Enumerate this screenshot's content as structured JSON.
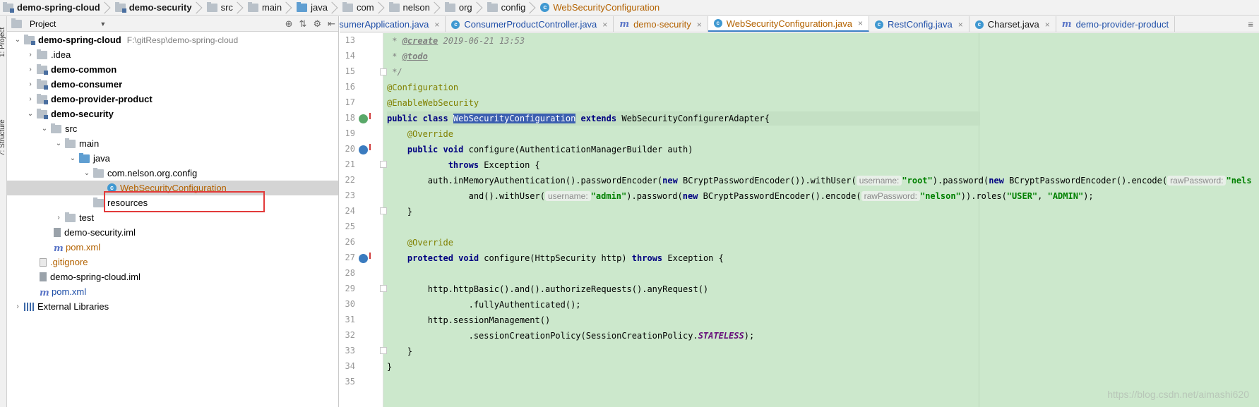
{
  "breadcrumb": [
    {
      "label": "demo-spring-cloud",
      "bold": true
    },
    {
      "label": "demo-security",
      "bold": true
    },
    {
      "label": "src"
    },
    {
      "label": "main"
    },
    {
      "label": "java"
    },
    {
      "label": "com"
    },
    {
      "label": "nelson"
    },
    {
      "label": "org"
    },
    {
      "label": "config"
    },
    {
      "label": "WebSecurityConfiguration",
      "current": true
    }
  ],
  "side_strip": {
    "project_tab": "1: Project",
    "structure_tab": "7: Structure"
  },
  "project_panel": {
    "title": "Project",
    "tree": [
      {
        "label": "demo-spring-cloud",
        "path": "F:\\gitResp\\demo-spring-cloud",
        "bold": true,
        "arrow": "down",
        "icon": "module"
      },
      {
        "label": ".idea",
        "arrow": "right",
        "icon": "folder"
      },
      {
        "label": "demo-common",
        "bold": true,
        "arrow": "right",
        "icon": "module"
      },
      {
        "label": "demo-consumer",
        "bold": true,
        "arrow": "right",
        "icon": "module"
      },
      {
        "label": "demo-provider-product",
        "bold": true,
        "arrow": "right",
        "icon": "module"
      },
      {
        "label": "demo-security",
        "bold": true,
        "arrow": "down",
        "icon": "module"
      },
      {
        "label": "src",
        "arrow": "down",
        "icon": "folder"
      },
      {
        "label": "main",
        "arrow": "down",
        "icon": "folder"
      },
      {
        "label": "java",
        "arrow": "down",
        "icon": "folder-blue"
      },
      {
        "label": "com.nelson.org.config",
        "arrow": "down",
        "icon": "folder"
      },
      {
        "label": "WebSecurityConfiguration",
        "icon": "class",
        "selected": true
      },
      {
        "label": "resources",
        "icon": "folder"
      },
      {
        "label": "test",
        "arrow": "right",
        "icon": "folder"
      },
      {
        "label": "demo-security.iml",
        "icon": "iml"
      },
      {
        "label": "pom.xml",
        "icon": "maven"
      },
      {
        "label": ".gitignore",
        "icon": "git"
      },
      {
        "label": "demo-spring-cloud.iml",
        "icon": "iml"
      },
      {
        "label": "pom.xml",
        "icon": "maven"
      },
      {
        "label": "External Libraries",
        "arrow": "right",
        "icon": "library"
      }
    ]
  },
  "tabs": [
    {
      "label": "nsumerApplication.java",
      "icon": "class",
      "closable": true
    },
    {
      "label": "ConsumerProductController.java",
      "icon": "class",
      "closable": true
    },
    {
      "label": "demo-security",
      "icon": "maven",
      "closable": true
    },
    {
      "label": "WebSecurityConfiguration.java",
      "icon": "class",
      "closable": true,
      "active": true
    },
    {
      "label": "RestConfig.java",
      "icon": "class",
      "closable": true
    },
    {
      "label": "Charset.java",
      "icon": "class",
      "closable": true
    },
    {
      "label": "demo-provider-product",
      "icon": "maven",
      "closable": false
    }
  ],
  "editor": {
    "line_numbers": [
      "13",
      "14",
      "15",
      "16",
      "17",
      "18",
      "19",
      "20",
      "21",
      "22",
      "23",
      "24",
      "25",
      "26",
      "27",
      "28",
      "29",
      "30",
      "31",
      "32",
      "33",
      "34",
      "35"
    ],
    "lines": {
      "l13a": " * ",
      "l13tag": "@create",
      "l13b": " 2019-06-21 13:53",
      "l14a": " * ",
      "l14tag": "@todo",
      "l15": " */",
      "l16": "@Configuration",
      "l17": "@EnableWebSecurity",
      "l18kw": "public class ",
      "l18sel": "WebSecurityConfiguration",
      "l18kw2": " extends ",
      "l18b": "WebSecurityConfigurerAdapter{",
      "l19": "    @Override",
      "l20kw": "    public void ",
      "l20b": "configure(AuthenticationManagerBuilder auth)",
      "l21kw": "            throws ",
      "l21b": "Exception {",
      "l22a": "        auth.inMemoryAuthentication().passwordEncoder(",
      "l22kw": "new ",
      "l22b": "BCryptPasswordEncoder()).withUser(",
      "l22hint1": "username:",
      "l22str1": "\"root\"",
      "l22c": ").password(",
      "l22kw2": "new ",
      "l22d": "BCryptPasswordEncoder().encode(",
      "l22hint2": "rawPassword:",
      "l22str2": "\"nels",
      "l23a": "                and().withUser(",
      "l23hint1": "username:",
      "l23str1": "\"admin\"",
      "l23b": ").password(",
      "l23kw": "new ",
      "l23c": "BCryptPasswordEncoder().encode(",
      "l23hint2": "rawPassword:",
      "l23str2": "\"nelson\"",
      "l23d": ")).roles(",
      "l23str3": "\"USER\"",
      "l23e": ", ",
      "l23str4": "\"ADMIN\"",
      "l23f": ");",
      "l24": "    }",
      "l26": "    @Override",
      "l27kw": "    protected void ",
      "l27b": "configure(HttpSecurity http) ",
      "l27kw2": "throws ",
      "l27c": "Exception {",
      "l29": "        http.httpBasic().and().authorizeRequests().anyRequest()",
      "l30": "                .fullyAuthenticated();",
      "l31": "        http.sessionManagement()",
      "l32a": "                .sessionCreationPolicy(SessionCreationPolicy.",
      "l32stat": "STATELESS",
      "l32b": ");",
      "l33": "    }",
      "l34": "}"
    }
  },
  "watermark": "https://blog.csdn.net/aimashi620"
}
